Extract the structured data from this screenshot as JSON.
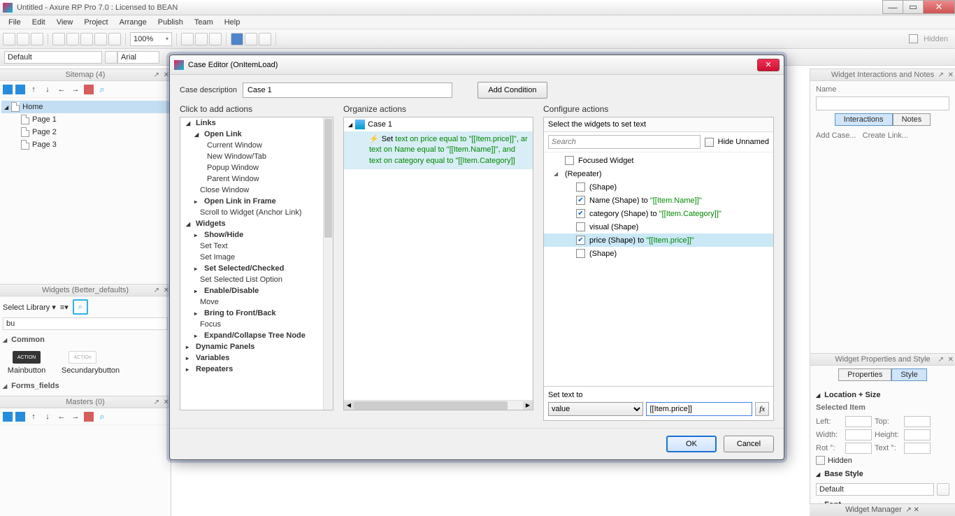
{
  "window": {
    "title": "Untitled - Axure RP Pro 7.0 : Licensed to BEAN"
  },
  "menu": [
    "File",
    "Edit",
    "View",
    "Project",
    "Arrange",
    "Publish",
    "Team",
    "Help"
  ],
  "toolbar": {
    "zoom": "100%",
    "hidden_label": "Hidden",
    "default_style": "Default",
    "font": "Arial"
  },
  "sitemap": {
    "title": "Sitemap (4)",
    "items": [
      {
        "label": "Home",
        "selected": true,
        "children": [
          {
            "label": "Page 1"
          },
          {
            "label": "Page 2"
          },
          {
            "label": "Page 3"
          }
        ]
      }
    ]
  },
  "widgets_panel": {
    "title": "Widgets (Better_defaults)",
    "select_library": "Select Library",
    "filter_value": "bu",
    "categories": [
      {
        "name": "Common",
        "items": [
          {
            "label": "Mainbutton",
            "thumb_text": "ACTION",
            "variant": "primary"
          },
          {
            "label": "Secundarybutton",
            "thumb_text": "ACTIOn",
            "variant": "secondary"
          }
        ]
      },
      {
        "name": "Forms_fields",
        "items": []
      }
    ]
  },
  "masters": {
    "title": "Masters (0)"
  },
  "interactions_panel": {
    "title": "Widget Interactions and Notes",
    "name_label": "Name",
    "tabs": [
      "Interactions",
      "Notes"
    ],
    "active_tab": "Interactions",
    "links": {
      "add_case": "Add Case...",
      "create_link": "Create Link..."
    }
  },
  "properties_panel": {
    "title": "Widget Properties and Style",
    "tabs": [
      "Properties",
      "Style"
    ],
    "active_tab": "Style",
    "sections": {
      "location_size": {
        "title": "Location + Size",
        "selected_item_label": "Selected Item",
        "fields": {
          "left": "Left:",
          "top": "Top:",
          "width": "Width:",
          "height": "Height:",
          "rot": "Rot °:",
          "text_rot": "Text °:"
        },
        "hidden_label": "Hidden"
      },
      "base_style": {
        "title": "Base Style",
        "value": "Default"
      },
      "font": {
        "title": "Font"
      }
    }
  },
  "widget_manager": {
    "title": "Widget Manager"
  },
  "modal": {
    "title": "Case Editor (OnItemLoad)",
    "case_description_label": "Case description",
    "case_description_value": "Case 1",
    "add_condition": "Add Condition",
    "col_titles": {
      "actions": "Click to add actions",
      "organize": "Organize actions",
      "configure": "Configure actions"
    },
    "actions_tree": [
      {
        "label": "Links",
        "type": "group",
        "expanded": true
      },
      {
        "label": "Open Link",
        "type": "group",
        "indent": 1,
        "expanded": true
      },
      {
        "label": "Current Window",
        "indent": 2
      },
      {
        "label": "New Window/Tab",
        "indent": 2
      },
      {
        "label": "Popup Window",
        "indent": 2
      },
      {
        "label": "Parent Window",
        "indent": 2
      },
      {
        "label": "Close Window",
        "indent": 1
      },
      {
        "label": "Open Link in Frame",
        "type": "group",
        "indent": 1,
        "collapsed": true
      },
      {
        "label": "Scroll to Widget (Anchor Link)",
        "indent": 1
      },
      {
        "label": "Widgets",
        "type": "group",
        "expanded": true
      },
      {
        "label": "Show/Hide",
        "type": "group",
        "indent": 1,
        "collapsed": true
      },
      {
        "label": "Set Text",
        "indent": 1
      },
      {
        "label": "Set Image",
        "indent": 1
      },
      {
        "label": "Set Selected/Checked",
        "type": "group",
        "indent": 1,
        "collapsed": true
      },
      {
        "label": "Set Selected List Option",
        "indent": 1
      },
      {
        "label": "Enable/Disable",
        "type": "group",
        "indent": 1,
        "collapsed": true
      },
      {
        "label": "Move",
        "indent": 1
      },
      {
        "label": "Bring to Front/Back",
        "type": "group",
        "indent": 1,
        "collapsed": true
      },
      {
        "label": "Focus",
        "indent": 1
      },
      {
        "label": "Expand/Collapse Tree Node",
        "type": "group",
        "indent": 1,
        "collapsed": true
      },
      {
        "label": "Dynamic Panels",
        "type": "group",
        "collapsed": true
      },
      {
        "label": "Variables",
        "type": "group",
        "collapsed": true
      },
      {
        "label": "Repeaters",
        "type": "group",
        "collapsed": true
      }
    ],
    "organize": {
      "case_label": "Case 1",
      "action_prefix": "Set",
      "action_lines": [
        "text on price equal to \"[[Item.price]]\", ar",
        "text on Name equal to \"[[Item.Name]]\", and",
        "text on category equal to \"[[Item.Category]]"
      ]
    },
    "configure": {
      "header": "Select the widgets to set text",
      "search_placeholder": "Search",
      "hide_unnamed": "Hide Unnamed",
      "tree": [
        {
          "label": "Focused Widget",
          "checked": false,
          "indent": 0
        },
        {
          "label": "(Repeater)",
          "expander": true,
          "indent": 0
        },
        {
          "label": "(Shape)",
          "checked": false,
          "indent": 1
        },
        {
          "label_parts": [
            "Name (Shape) to ",
            "\"[[Item.Name]]\""
          ],
          "checked": true,
          "indent": 1
        },
        {
          "label_parts": [
            "category (Shape) to ",
            "\"[[Item.Category]]\""
          ],
          "checked": true,
          "indent": 1
        },
        {
          "label": "visual (Shape)",
          "checked": false,
          "indent": 1
        },
        {
          "label_parts": [
            "price (Shape) to ",
            "\"[[Item.price]]\""
          ],
          "checked": true,
          "indent": 1,
          "selected": true
        },
        {
          "label": "(Shape)",
          "checked": false,
          "indent": 1
        }
      ],
      "set_text_label": "Set text to",
      "mode": "value",
      "value": "[[Item.price]]",
      "fx": "fx"
    },
    "buttons": {
      "ok": "OK",
      "cancel": "Cancel"
    }
  }
}
